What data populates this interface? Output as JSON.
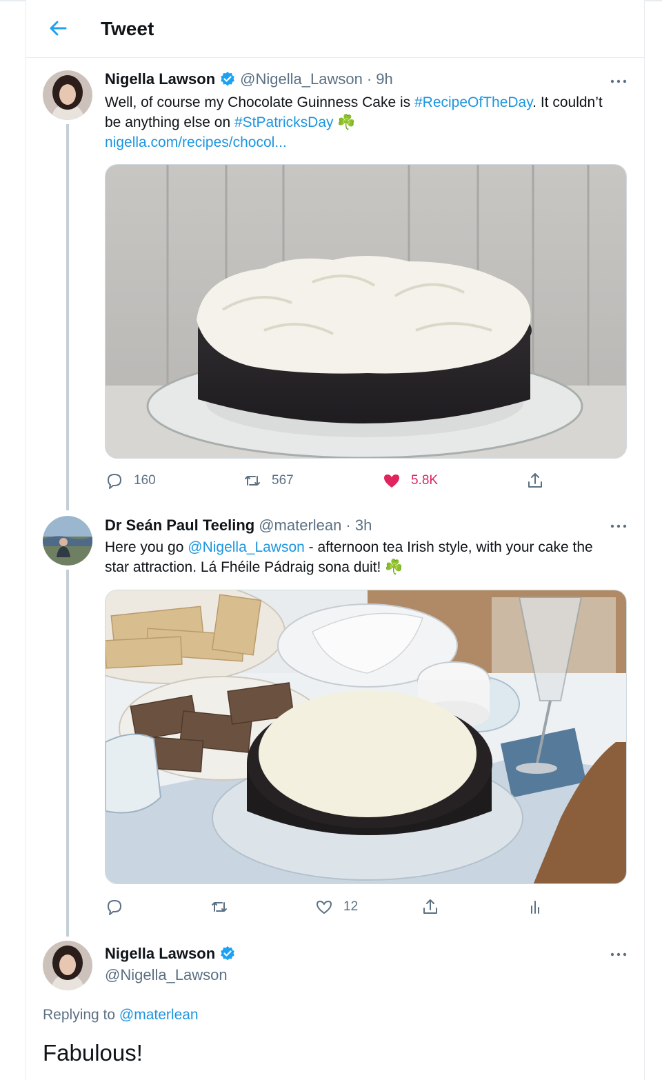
{
  "header": {
    "title": "Tweet"
  },
  "tweet1": {
    "name": "Nigella Lawson",
    "handle": "@Nigella_Lawson",
    "time": "· 9h",
    "text_1": "Well, of course my Chocolate Guinness Cake is ",
    "hashtag_1": "#RecipeOfTheDay",
    "text_2": ". It couldn’t be anything else on ",
    "hashtag_2": "#StPatricksDay",
    "emoji": "☘️",
    "link": "nigella.com/recipes/chocol...",
    "replies": "160",
    "retweets": "567",
    "likes": "5.8K"
  },
  "tweet2": {
    "name": "Dr Seán Paul Teeling",
    "handle": "@materlean",
    "time": "· 3h",
    "text_1": "Here you go ",
    "mention": "@Nigella_Lawson",
    "text_2": " - afternoon tea Irish style, with your cake the star attraction. Lá Fhéile Pádraig sona duit! ",
    "emoji": "☘️",
    "likes": "12"
  },
  "tweet3": {
    "name": "Nigella Lawson",
    "handle": "@Nigella_Lawson",
    "replying_label": "Replying to",
    "replying_handle": "@materlean",
    "text": "Fabulous!"
  },
  "colors": {
    "link": "#1b95e0",
    "like": "#e0245e",
    "secondary": "#5b7083",
    "verified": "#1da1f2"
  }
}
